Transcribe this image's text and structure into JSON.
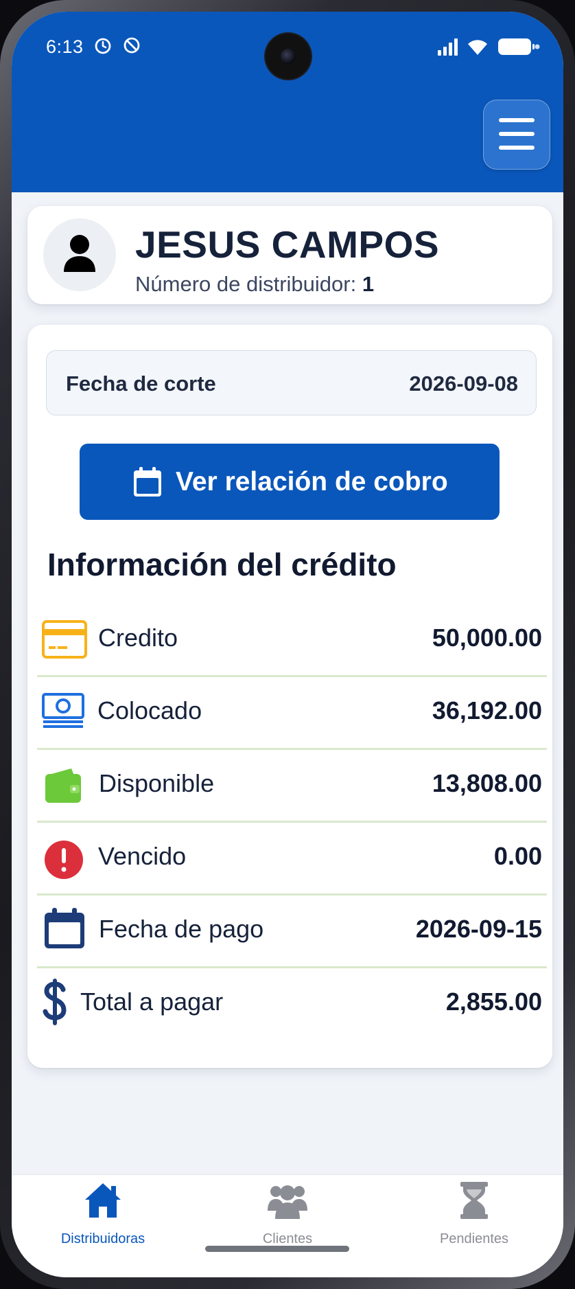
{
  "status_bar": {
    "time": "6:13",
    "icons": [
      "alarm-icon",
      "do-not-disturb-icon",
      "signal-icon",
      "wifi-icon",
      "battery-icon"
    ]
  },
  "header": {
    "menu_icon": "hamburger-menu-icon",
    "color": "#0a57bb"
  },
  "profile": {
    "name": "JESUS CAMPOS",
    "number_label": "Número de distribuidor:",
    "number_value": "1"
  },
  "cutoff": {
    "label": "Fecha de corte",
    "value": "2026-09-08"
  },
  "relation_button": {
    "label": "Ver relación de cobro",
    "icon": "calendar-icon"
  },
  "credit_info": {
    "title": "Información del crédito",
    "rows": [
      {
        "icon": "credit-card-icon",
        "label": "Credito",
        "value": "50,000.00",
        "color": "#f7b21a"
      },
      {
        "icon": "money-stack-icon",
        "label": "Colocado",
        "value": "36,192.00",
        "color": "#1f6fe0"
      },
      {
        "icon": "wallet-icon",
        "label": "Disponible",
        "value": "13,808.00",
        "color": "#6cc93a"
      },
      {
        "icon": "alert-circle-icon",
        "label": "Vencido",
        "value": "0.00",
        "color": "#dc2f3c"
      },
      {
        "icon": "calendar-icon",
        "label": "Fecha de pago",
        "value": "2026-09-15",
        "color": "#1d3c78"
      },
      {
        "icon": "dollar-icon",
        "label": "Total a pagar",
        "value": "2,855.00",
        "color": "#1d3c78"
      }
    ]
  },
  "bottom_nav": {
    "items": [
      {
        "label": "Distribuidoras",
        "icon": "home-icon",
        "active": true
      },
      {
        "label": "Clientes",
        "icon": "users-icon",
        "active": false
      },
      {
        "label": "Pendientes",
        "icon": "hourglass-icon",
        "active": false
      }
    ],
    "active_color": "#0a57bb",
    "inactive_color": "#8a8d93"
  }
}
